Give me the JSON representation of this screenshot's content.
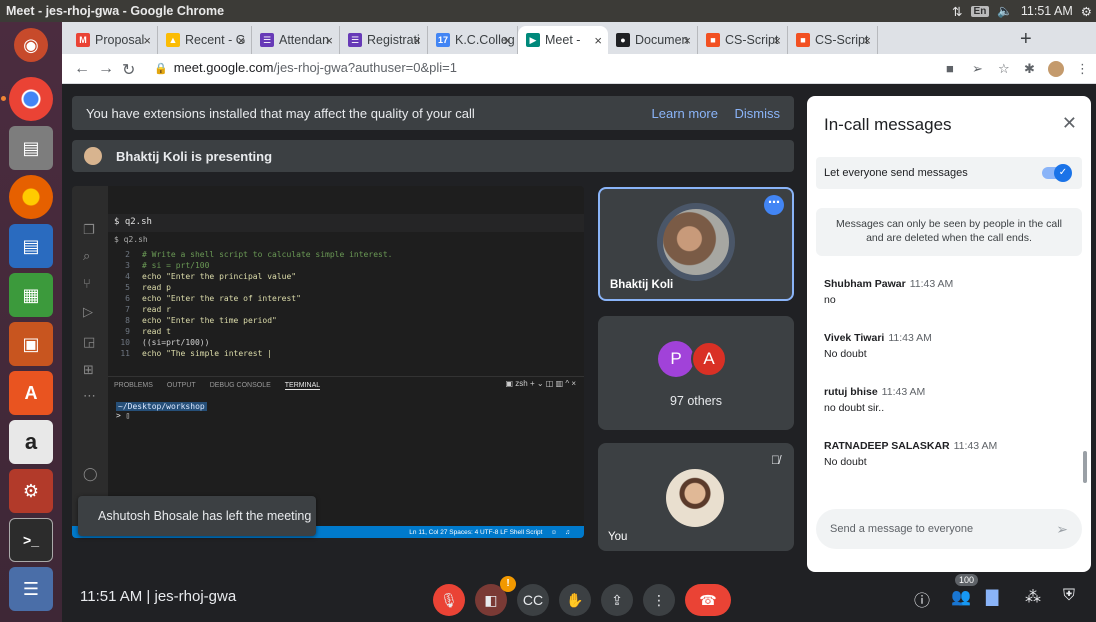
{
  "os": {
    "window_title": "Meet - jes-rhoj-gwa - Google Chrome",
    "keyboard_layout": "En",
    "clock": "11:51 AM"
  },
  "tabs": [
    {
      "label": "Proposal",
      "icon": "gmail-icon",
      "color": "#ea4335",
      "glyph": "M"
    },
    {
      "label": "Recent - G",
      "icon": "drive-icon",
      "color": "#fbbc04",
      "glyph": "▲"
    },
    {
      "label": "Attendan",
      "icon": "forms-icon",
      "color": "#673ab7",
      "glyph": "☰"
    },
    {
      "label": "Registrati",
      "icon": "forms-icon",
      "color": "#673ab7",
      "glyph": "☰"
    },
    {
      "label": "K.C.Colleg",
      "icon": "calendar-icon",
      "color": "#4285f4",
      "glyph": "17"
    },
    {
      "label": "Meet -",
      "icon": "meet-icon",
      "color": "#00897b",
      "glyph": "▶"
    },
    {
      "label": "Documen",
      "icon": "github-icon",
      "color": "#202124",
      "glyph": "●"
    },
    {
      "label": "CS-Script",
      "icon": "microsoft-icon",
      "color": "#f25022",
      "glyph": "■"
    },
    {
      "label": "CS-Script",
      "icon": "microsoft-icon",
      "color": "#f25022",
      "glyph": "■"
    }
  ],
  "address": {
    "host": "meet.google.com",
    "path": "/jes-rhoj-gwa?authuser=0&pli=1"
  },
  "banner": {
    "text": "You have extensions installed that may affect the quality of your call",
    "learn_more": "Learn more",
    "dismiss": "Dismiss"
  },
  "presenting": "Bhaktij Koli is presenting",
  "vscode": {
    "tab": "$ q2.sh",
    "breadcrumb": "$ q2.sh",
    "lines": [
      {
        "n": "2",
        "t": "# Write a shell script to calculate simple interest.",
        "k": "cm"
      },
      {
        "n": "3",
        "t": "# si = prt/100",
        "k": "cm"
      },
      {
        "n": "4",
        "t": "echo \"Enter the principal value\"",
        "k": "kw"
      },
      {
        "n": "5",
        "t": "read p",
        "k": "kw"
      },
      {
        "n": "6",
        "t": "echo \"Enter the rate of interest\"",
        "k": "kw"
      },
      {
        "n": "7",
        "t": "read r",
        "k": "kw"
      },
      {
        "n": "8",
        "t": "echo \"Enter the time period\"",
        "k": "kw"
      },
      {
        "n": "9",
        "t": "read t",
        "k": "kw"
      },
      {
        "n": "10",
        "t": "((si=prt/100))",
        "k": "tx"
      },
      {
        "n": "11",
        "t": "echo \"The simple interest |",
        "k": "kw"
      }
    ],
    "panel_tabs": [
      "PROBLEMS",
      "OUTPUT",
      "DEBUG CONSOLE",
      "TERMINAL"
    ],
    "terminal_path": "~/Desktop/workshop",
    "terminal_prompt": "> ▯",
    "status": "Ln 11, Col 27   Spaces: 4   UTF-8   LF   Shell Script"
  },
  "toast": "Ashutosh Bhosale has left the meeting",
  "tiles": {
    "presenter_name": "Bhaktij Koli",
    "others_initials": [
      "P",
      "A"
    ],
    "others_label": "97 others",
    "you_label": "You"
  },
  "bottom": {
    "time_code": "11:51 AM  |  jes-rhoj-gwa",
    "people_count": "100"
  },
  "chat": {
    "title": "In-call messages",
    "everyone_label": "Let everyone send messages",
    "notice": "Messages can only be seen by people in the call and are deleted when the call ends.",
    "messages": [
      {
        "sender": "Shubham Pawar",
        "time": "11:43 AM",
        "text": "no"
      },
      {
        "sender": "Vivek Tiwari",
        "time": "11:43 AM",
        "text": "No doubt"
      },
      {
        "sender": "rutuj bhise",
        "time": "11:43 AM",
        "text": "no doubt sir.."
      },
      {
        "sender": "RATNADEEP SALASKAR",
        "time": "11:43 AM",
        "text": "No doubt"
      }
    ],
    "input_placeholder": "Send a message to everyone"
  }
}
